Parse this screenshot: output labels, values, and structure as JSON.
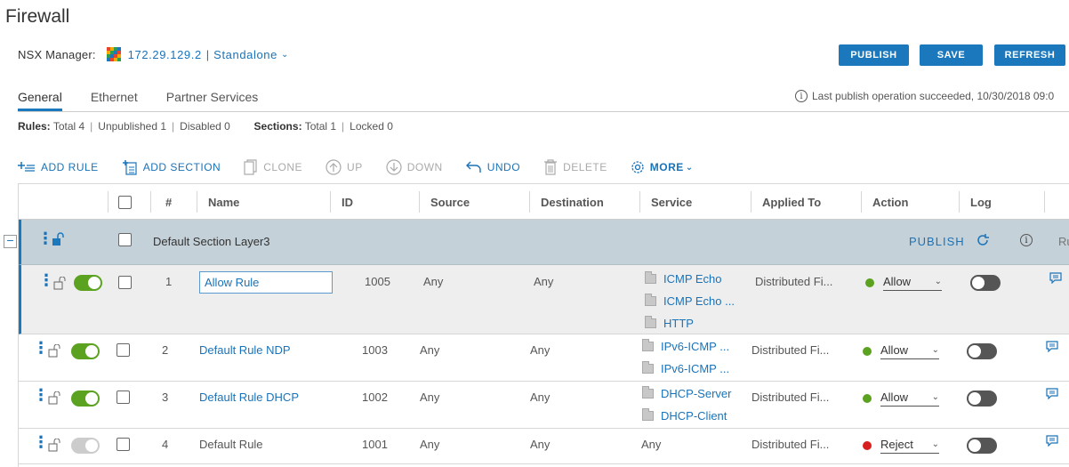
{
  "page": {
    "title": "Firewall"
  },
  "manager": {
    "label": "NSX Manager:",
    "ip": "172.29.129.2",
    "sep": "|",
    "mode": "Standalone"
  },
  "actions": {
    "publish": "PUBLISH",
    "save": "SAVE",
    "refresh": "REFRESH"
  },
  "tabs": [
    {
      "label": "General",
      "active": true
    },
    {
      "label": "Ethernet",
      "active": false
    },
    {
      "label": "Partner Services",
      "active": false
    }
  ],
  "last_publish": "Last publish operation succeeded, 10/30/2018 09:0",
  "stats": {
    "rules_label": "Rules:",
    "rules_total": "Total 4",
    "unpublished": "Unpublished 1",
    "disabled": "Disabled 0",
    "sections_label": "Sections:",
    "sections_total": "Total 1",
    "locked": "Locked 0"
  },
  "toolbar": {
    "add_rule": "ADD RULE",
    "add_section": "ADD SECTION",
    "clone": "CLONE",
    "up": "UP",
    "down": "DOWN",
    "undo": "UNDO",
    "delete": "DELETE",
    "more": "MORE"
  },
  "columns": {
    "num": "#",
    "name": "Name",
    "id": "ID",
    "source": "Source",
    "destination": "Destination",
    "service": "Service",
    "applied_to": "Applied To",
    "action": "Action",
    "log": "Log"
  },
  "section": {
    "name": "Default Section Layer3",
    "publish": "PUBLISH",
    "extra": "Ru"
  },
  "rules": [
    {
      "num": "1",
      "name": "Allow Rule",
      "id": "1005",
      "source": "Any",
      "destination": "Any",
      "services": [
        "ICMP Echo",
        "ICMP Echo ...",
        "HTTP"
      ],
      "applied_to": "Distributed Fi...",
      "action": "Allow",
      "action_color": "#5aa220"
    },
    {
      "num": "2",
      "name": "Default Rule NDP",
      "id": "1003",
      "source": "Any",
      "destination": "Any",
      "services": [
        "IPv6-ICMP ...",
        "IPv6-ICMP ..."
      ],
      "applied_to": "Distributed Fi...",
      "action": "Allow",
      "action_color": "#5aa220"
    },
    {
      "num": "3",
      "name": "Default Rule DHCP",
      "id": "1002",
      "source": "Any",
      "destination": "Any",
      "services": [
        "DHCP-Server",
        "DHCP-Client"
      ],
      "applied_to": "Distributed Fi...",
      "action": "Allow",
      "action_color": "#5aa220"
    },
    {
      "num": "4",
      "name": "Default Rule",
      "id": "1001",
      "source": "Any",
      "destination": "Any",
      "service_text": "Any",
      "applied_to": "Distributed Fi...",
      "action": "Reject",
      "action_color": "#d81f1f"
    }
  ],
  "colors": {
    "accent": "#1b78bd",
    "link": "#1a73b8",
    "section_bg": "#c5d1d9",
    "allow": "#5aa220",
    "reject": "#d81f1f"
  }
}
